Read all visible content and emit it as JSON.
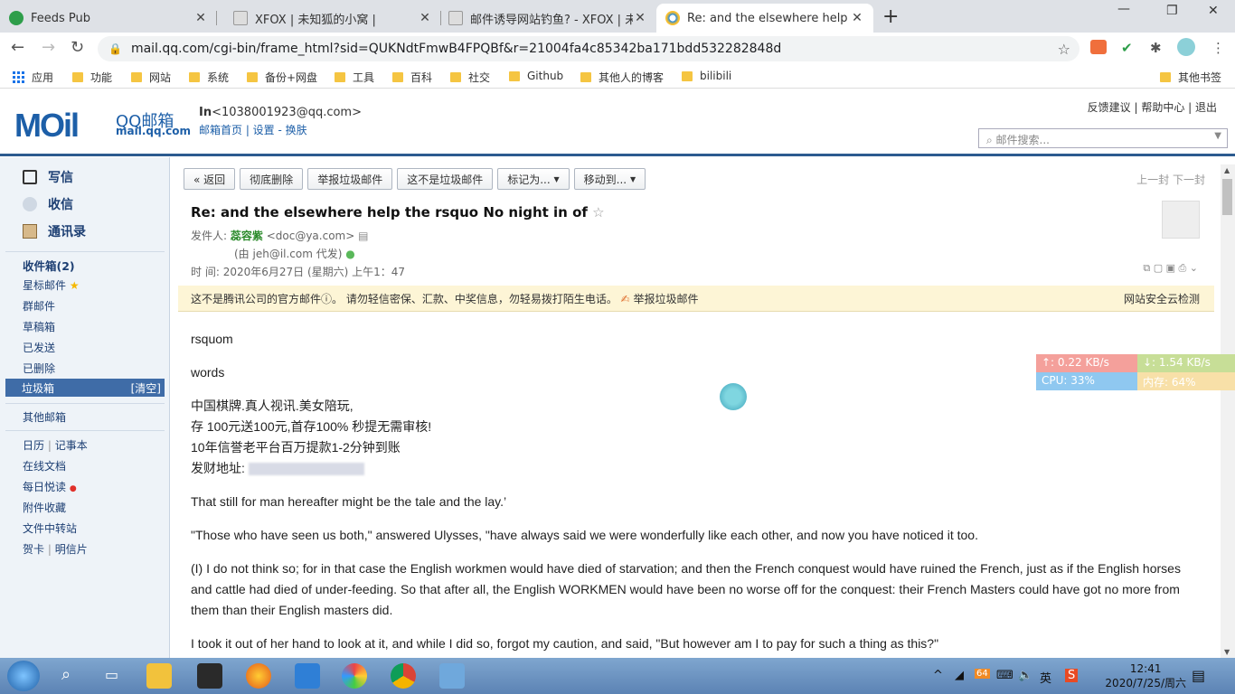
{
  "browser": {
    "tabs": [
      {
        "title": "Feeds Pub",
        "active": false
      },
      {
        "title": "XFOX | 未知狐的小窝 |",
        "active": false
      },
      {
        "title": "邮件诱导网站钓鱼? - XFOX | 未",
        "active": false
      },
      {
        "title": "Re:  and the elsewhere help th",
        "active": true
      }
    ],
    "new_tab": "+",
    "url": "mail.qq.com/cgi-bin/frame_html?sid=QUKNdtFmwB4FPQBf&r=21004fa4c85342ba171bdd532282848d",
    "bookmarks": [
      "应用",
      "功能",
      "网站",
      "系统",
      "备份+网盘",
      "工具",
      "百科",
      "社交",
      "Github",
      "其他人的博客",
      "bilibili"
    ],
    "other_bookmarks": "其他书签"
  },
  "header": {
    "logo_text": "MOil",
    "brand": "QQ邮箱",
    "domain": "mail.qq.com",
    "user_name": "In",
    "user_email": "<1038001923@qq.com>",
    "user_links": "邮箱首页 | 设置 - 换肤",
    "top_links": "反馈建议 | 帮助中心 | 退出",
    "search_placeholder": "邮件搜索..."
  },
  "sidebar": {
    "compose": "写信",
    "inbox_check": "收信",
    "contacts": "通讯录",
    "inbox": "收件箱(2)",
    "starred": "星标邮件",
    "group": "群邮件",
    "drafts": "草稿箱",
    "sent": "已发送",
    "deleted": "已删除",
    "spam": "垃圾箱",
    "spam_clear": "[清空]",
    "other_mailboxes": "其他邮箱",
    "calendar": "日历",
    "notes": "记事本",
    "docs": "在线文档",
    "daily": "每日悦读",
    "attachments": "附件收藏",
    "transfer": "文件中转站",
    "cards": "贺卡",
    "postcards": "明信片"
  },
  "toolbar": {
    "back": "« 返回",
    "delete": "彻底删除",
    "report_spam": "举报垃圾邮件",
    "not_spam": "这不是垃圾邮件",
    "mark_as": "标记为...",
    "move_to": "移动到...",
    "prev_next": "上一封  下一封"
  },
  "mail": {
    "subject": "Re:  and the elsewhere help the rsquo No night in of",
    "from_label": "发件人:",
    "from_name": "蕊容紫",
    "from_addr": "<doc@ya.com>",
    "proxy": "(由 jeh@il.com 代发)",
    "time_label": "时    间:",
    "time": "2020年6月27日 (星期六) 上午1：47",
    "warning": "这不是腾讯公司的官方邮件ⓘ。   请勿轻信密保、汇款、中奖信息，勿轻易拨打陌生电话。",
    "warning_report": "举报垃圾邮件",
    "security_check": "网站安全云检测",
    "body": [
      "rsquom",
      "words",
      "中国棋牌.真人视讯.美女陪玩,",
      "存 100元送100元,首存100% 秒提无需审核!",
      "10年信誉老平台百万提款1-2分钟到账",
      "发财地址:",
      "That still for man hereafter might be the tale and the lay.’",
      "\"Those who have seen us both,\" answered Ulysses, \"have always said we were wonderfully like each other, and now you have noticed it too.",
      "(I) I do not think so; for in that case the English workmen would have died of starvation; and then the French conquest would have ruined the French, just as if the English horses and cattle had died of under-feeding. So that after all, the English WORKMEN would have been no worse off for the conquest: their French Masters could have got no more from them than their English masters did.",
      "I took it out of her hand to look at it, and while I did so, forgot my caution, and said, \"But however am I to pay for such a thing as this?\""
    ]
  },
  "netmon": {
    "up": "↑: 0.22 KB/s",
    "down": "↓: 1.54 KB/s",
    "cpu": "CPU: 33%",
    "mem": "内存: 64%"
  },
  "taskbar": {
    "time": "12:41",
    "date": "2020/7/25/周六",
    "tray_badge": "64"
  }
}
